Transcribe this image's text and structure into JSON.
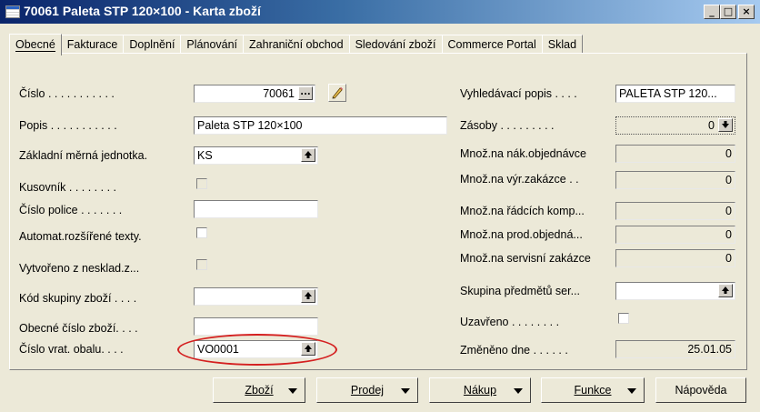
{
  "window": {
    "title": "70061 Paleta STP 120×100 - Karta zboží",
    "controls": {
      "minimize": "_",
      "maximize": "□",
      "close": "×"
    }
  },
  "tabs": [
    {
      "label": "Obecné",
      "active": true
    },
    {
      "label": "Fakturace"
    },
    {
      "label": "Doplnění"
    },
    {
      "label": "Plánování"
    },
    {
      "label": "Zahraniční obchod"
    },
    {
      "label": "Sledování zboží"
    },
    {
      "label": "Commerce Portal"
    },
    {
      "label": "Sklad"
    }
  ],
  "left": {
    "cislo": {
      "label": "Číslo . . . . . . . . . . .",
      "value": "70061",
      "button": "..."
    },
    "popis": {
      "label": "Popis . . . . . . . . . . .",
      "value": "Paleta STP 120×100"
    },
    "jednotka": {
      "label": "Základní měrná jednotka.",
      "value": "KS"
    },
    "kusovnik": {
      "label": "Kusovník . . . . . . . ."
    },
    "cislo_police": {
      "label": "Číslo police . . . . . . .",
      "value": ""
    },
    "automat": {
      "label": "Automat.rozšířené texty."
    },
    "vytvoreno": {
      "label": "Vytvořeno z nesklad.z..."
    },
    "kod_skupiny": {
      "label": "Kód skupiny zboží . . . .",
      "value": ""
    },
    "obecne_cislo": {
      "label": "Obecné číslo zboží. . . .",
      "value": ""
    },
    "cislo_vrat": {
      "label": "Číslo vrat. obalu. . . .",
      "value": "VO0001"
    }
  },
  "right": {
    "vyhledavaci": {
      "label": "Vyhledávací popis . . . .",
      "value": "PALETA STP 120..."
    },
    "zasoby": {
      "label": "Zásoby . . . . . . . . .",
      "value": "0"
    },
    "mnoz_nak": {
      "label": "Množ.na nák.objednávce",
      "value": "0"
    },
    "mnoz_vyr": {
      "label": "Množ.na výr.zakázce . .",
      "value": "0"
    },
    "mnoz_radcich": {
      "label": "Množ.na řádcích komp...",
      "value": "0"
    },
    "mnoz_prod": {
      "label": "Množ.na prod.objedná...",
      "value": "0"
    },
    "mnoz_serv": {
      "label": "Množ.na servisní zakázce",
      "value": "0"
    },
    "skupina": {
      "label": "Skupina předmětů ser...",
      "value": ""
    },
    "uzavreno": {
      "label": "Uzavřeno . . . . . . . ."
    },
    "zmeneno": {
      "label": "Změněno dne . . . . . .",
      "value": "25.01.05"
    }
  },
  "footer": {
    "zbozi": "Zboží",
    "prodej": "Prodej",
    "nakup": "Nákup",
    "funkce": "Funkce",
    "napoveda": "Nápověda"
  },
  "icons": {
    "lookup": "lookup-arrow-icon",
    "pencil": "pencil-icon",
    "dropdown": "dropdown-arrow-icon"
  },
  "colors": {
    "highlight_ellipse": "#d42020",
    "title_bar": "#0a246a"
  }
}
